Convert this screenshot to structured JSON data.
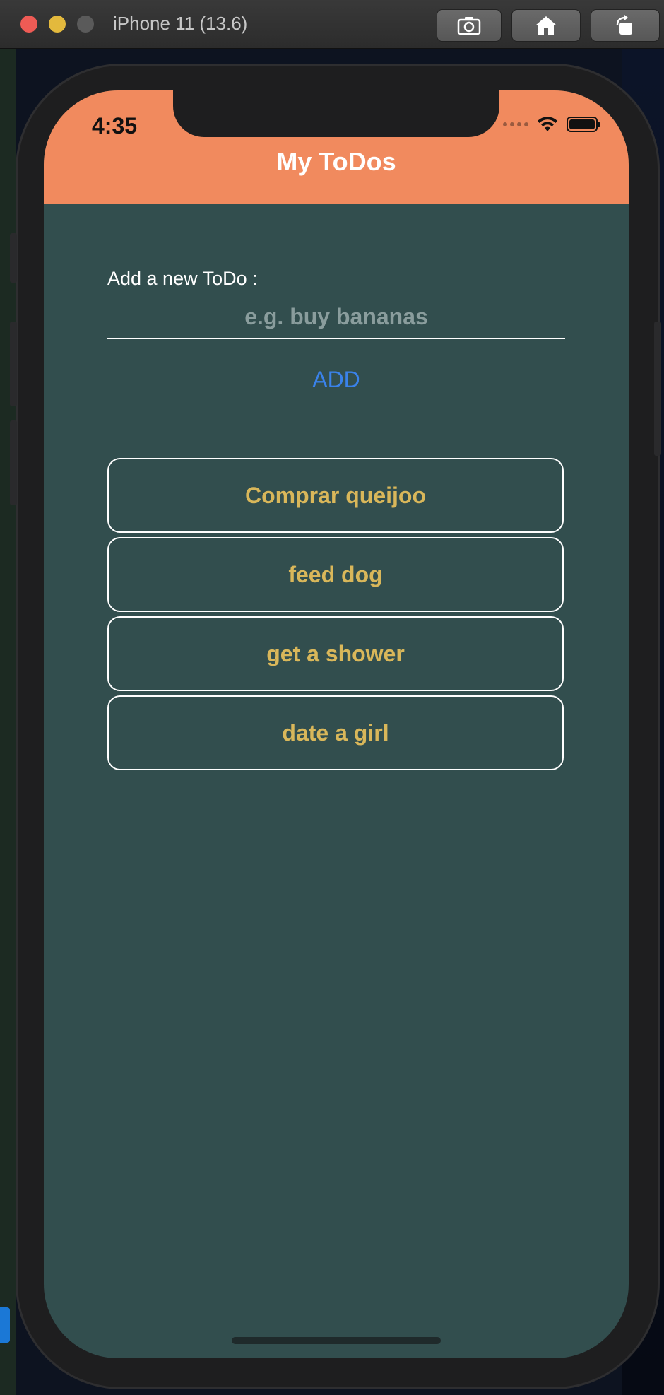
{
  "simulator": {
    "title": "iPhone 11 (13.6)",
    "buttons": [
      "screenshot-icon",
      "home-icon",
      "rotate-icon"
    ]
  },
  "status_bar": {
    "time": "4:35"
  },
  "app": {
    "title": "My ToDos",
    "accent_color": "#f18a5e",
    "background_color": "#324e4e"
  },
  "form": {
    "label": "Add a new ToDo :",
    "placeholder": "e.g. buy bananas",
    "value": "",
    "add_label": "ADD"
  },
  "todos": [
    {
      "text": "Comprar queijoo"
    },
    {
      "text": "feed dog"
    },
    {
      "text": "get a shower"
    },
    {
      "text": "date a girl"
    }
  ]
}
